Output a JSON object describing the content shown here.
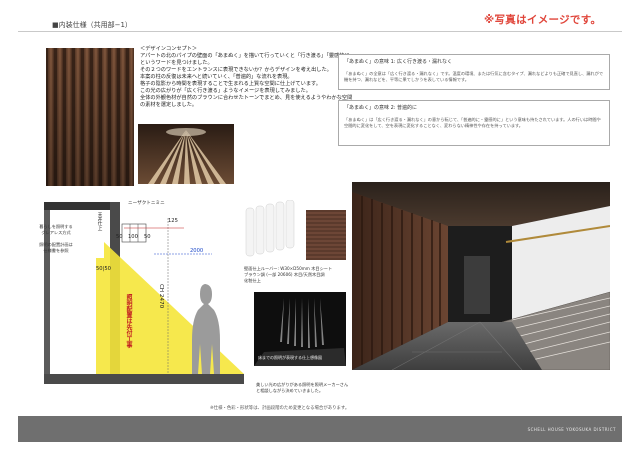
{
  "header": {
    "section_title": "■内装仕様（共用部−1）",
    "notice": "※写真はイメージです。"
  },
  "concept": {
    "heading": "＜デザインコンセプト＞",
    "lines": [
      "アパートの北のパイプの壁面の「あまぬく」を描いて行っていくと「行き渡る」「靈感的に」",
      "というワードを見つけました。",
      "その２つのワードをエントランスに表現できないか？からデザインを考え出した。",
      "本案の柱の反復は未来へと続いていく、「普遍的」な流れを表現。",
      "格子の陰影から時間を表現することで生まれる上質な空間に仕上げています。",
      "この光の広がりが「広く行き渡る」ようなイメージを表現してみました。",
      "全体の外観色材が自然のブラウンに合わせたトーンでまとめ、見を使えるようやわかな空間",
      "の素材を選定しました。"
    ]
  },
  "right_boxes": [
    {
      "title": "「あまぬく」の意味 1: 広く行き渡る・漏れなく",
      "body": "「あまぬく」の全意は「広く行き渡る・漏れなく」です。温度の環境、または行気に含むタイプ、漏れなどよりも正確で見直し、漏れがで機を持つ、漏れなどを、平等に果てしかうを表している情報です。"
    },
    {
      "title": "「あまぬく」の意味 2: 普遍的に",
      "body": "「あまぬく」は「広く行き渡る・漏れなく」の意から転じて、「普遍的に・靈感的に」という意味も持たされています。人の行いは時間や空間的に変化をして、空を表現に変化することなく、変わらない精神性や存在を持っています。"
    }
  ],
  "section_labels": {
    "left_note_lines": [
      "暮らしを照明する",
      "グレアレス方式",
      "照明の配置計画は",
      "仕様書を参照"
    ],
    "wall_top_label": "ニーザクトニミニ",
    "dim_125": "125",
    "dim_50a": "50",
    "dim_100": "100",
    "dim_50b": "50",
    "dim_2000": "2000",
    "dim_5050": "50|50",
    "ch_label": "CH 2470",
    "ceiling_label": "天井仕上",
    "light_label": "照明配置は先付工事",
    "wall_finish": "壁仕上"
  },
  "material": {
    "caption_lines": [
      "壁面仕上ルーバー: W30×D50mm 木目シート",
      "ブラウン調 (一部 20606) 木目/天然木目調",
      "化粧仕上"
    ]
  },
  "light_photo": {
    "caption": "床までの照明が表現する仕上想像図"
  },
  "bottom_caption": {
    "lines": [
      "美しい光の広がりがある照明を照明メーカーさん",
      "と相談しながら決めていきました。"
    ]
  },
  "footnote": "※仕様・色彩・形状等は、計画段階のため変更となる場合があります。",
  "footer_brand": "SCHELL HOUSE YOKOSUKA DISTRICT"
}
